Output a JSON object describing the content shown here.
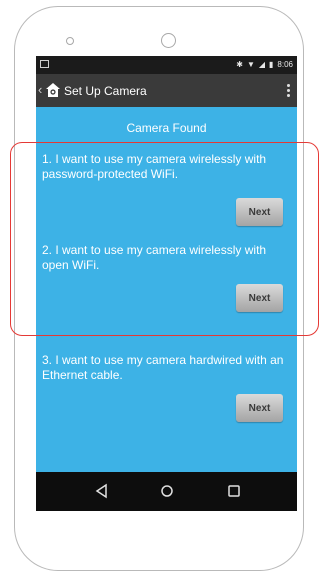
{
  "app": {
    "title": "Set Up Camera"
  },
  "status_bar": {
    "time": "8:06"
  },
  "content": {
    "heading": "Camera Found",
    "options": [
      {
        "text": "1. I want to use my camera wirelessly with password-protected WiFi.",
        "button": "Next"
      },
      {
        "text": "2. I want to use my camera wirelessly with open WiFi.",
        "button": "Next"
      },
      {
        "text": "3. I want to use my camera hardwired with an Ethernet cable.",
        "button": "Next"
      }
    ]
  },
  "icons": {
    "back": "back-arrow-icon",
    "app_logo": "house-logo-icon",
    "overflow": "overflow-menu-icon",
    "nav_back": "nav-back-icon",
    "nav_home": "nav-home-icon",
    "nav_recent": "nav-recents-icon"
  },
  "colors": {
    "content_bg": "#3db2e6",
    "app_bar": "#3a3a3a",
    "highlight": "#e53935"
  }
}
